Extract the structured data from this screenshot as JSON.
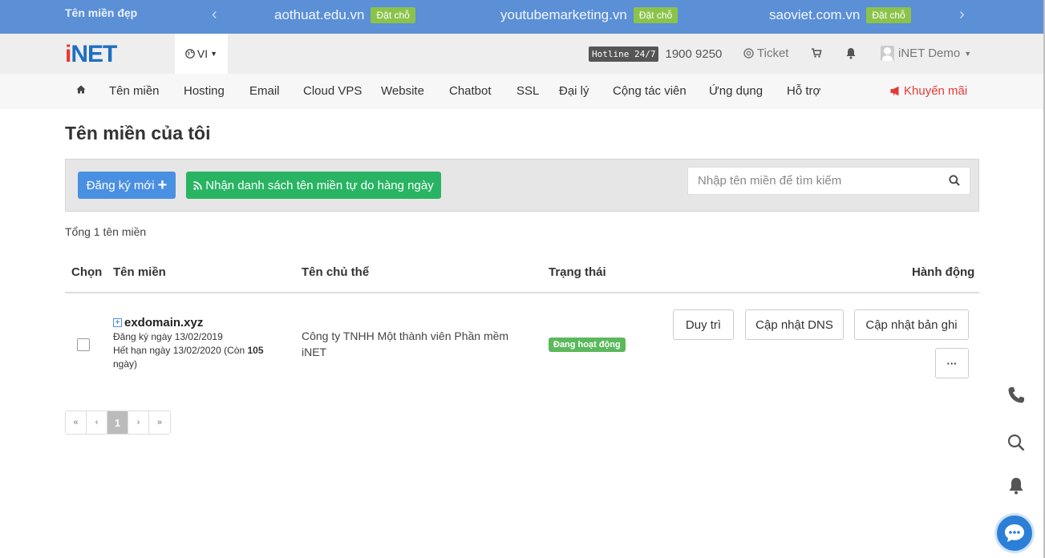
{
  "promo": {
    "title": "Tên miền đẹp",
    "items": [
      {
        "domain": "aothuat.edu.vn",
        "badge": "Đặt chỗ"
      },
      {
        "domain": "youtubemarketing.vn",
        "badge": "Đặt chỗ"
      },
      {
        "domain": "saoviet.com.vn",
        "badge": "Đặt chỗ"
      }
    ]
  },
  "header": {
    "logo_i": "i",
    "logo_net": "NET",
    "language": "VI",
    "hotline_tag": "Hotline 24/7",
    "hotline_number": "1900 9250",
    "ticket": "Ticket",
    "user": "iNET Demo"
  },
  "nav": {
    "items": [
      "Tên miền",
      "Hosting",
      "Email",
      "Cloud VPS",
      "Website",
      "Chatbot",
      "SSL",
      "Đại lý",
      "Cộng tác viên",
      "Ứng dụng",
      "Hỗ trợ"
    ],
    "promo": "Khuyến mãi"
  },
  "main": {
    "title": "Tên miền của tôi",
    "register_button": "Đăng ký mới",
    "expired_list_button": "Nhận danh sách tên miền tự do hàng ngày",
    "search_placeholder": "Nhập tên miền để tìm kiếm",
    "total": "Tổng 1 tên miền",
    "columns": {
      "select": "Chọn",
      "domain": "Tên miền",
      "owner": "Tên chủ thể",
      "status": "Trạng thái",
      "actions": "Hành động"
    },
    "rows": [
      {
        "domain": "exdomain.xyz",
        "registered": "Đăng ký ngày 13/02/2019",
        "expires_prefix": "Hết hạn ngày 13/02/2020 (Còn ",
        "days_left": "105",
        "expires_suffix": "ngày)",
        "owner": "Công ty TNHH Một thành viên Phần mềm iNET",
        "status": "Đang hoạt động",
        "actions": {
          "renew": "Duy trì",
          "update_dns": "Cập nhật DNS",
          "update_records": "Cập nhật bản ghi",
          "more": "···"
        }
      }
    ]
  },
  "pagination": {
    "first": "«",
    "prev": "‹",
    "current": "1",
    "next": "›",
    "last": "»"
  },
  "colors": {
    "promo_bar": "#5b8fd6",
    "primary": "#4a90e2",
    "success": "#28b463",
    "status_active": "#5cb85c",
    "promo_text": "#e53935"
  }
}
